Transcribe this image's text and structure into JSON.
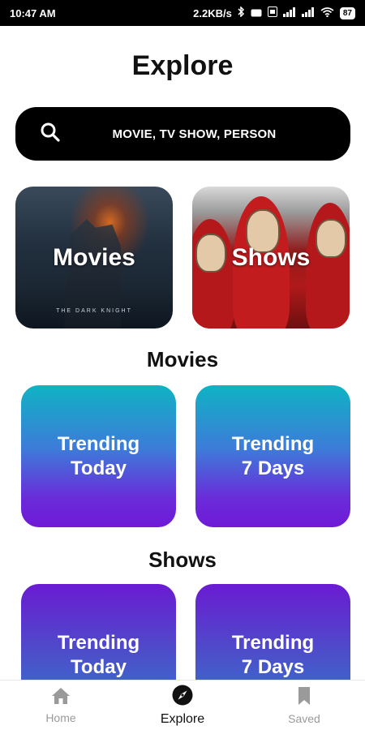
{
  "status_bar": {
    "time": "10:47 AM",
    "network_speed": "2.2KB/s",
    "battery": "87"
  },
  "header": {
    "title": "Explore"
  },
  "search": {
    "placeholder": "MOVIE, TV SHOW, PERSON"
  },
  "categories": [
    {
      "label": "Movies",
      "poster_caption": "THE DARK KNIGHT"
    },
    {
      "label": "Shows"
    }
  ],
  "sections": [
    {
      "title": "Movies",
      "cards": [
        {
          "label": "Trending\nToday"
        },
        {
          "label": "Trending\n7 Days"
        }
      ]
    },
    {
      "title": "Shows",
      "cards": [
        {
          "label": "Trending\nToday"
        },
        {
          "label": "Trending\n7 Days"
        }
      ]
    }
  ],
  "bottom_nav": {
    "items": [
      {
        "label": "Home",
        "icon": "home-icon",
        "active": false
      },
      {
        "label": "Explore",
        "icon": "compass-icon",
        "active": true
      },
      {
        "label": "Saved",
        "icon": "bookmark-icon",
        "active": false
      }
    ]
  },
  "colors": {
    "search_bg": "#000000",
    "movies_card_gradient": [
      "#0fb3c4",
      "#6f1ad6"
    ],
    "shows_card_gradient": [
      "#6a1bd2",
      "#2d7fd0"
    ],
    "nav_active": "#111111",
    "nav_inactive": "#9a9a9a"
  }
}
